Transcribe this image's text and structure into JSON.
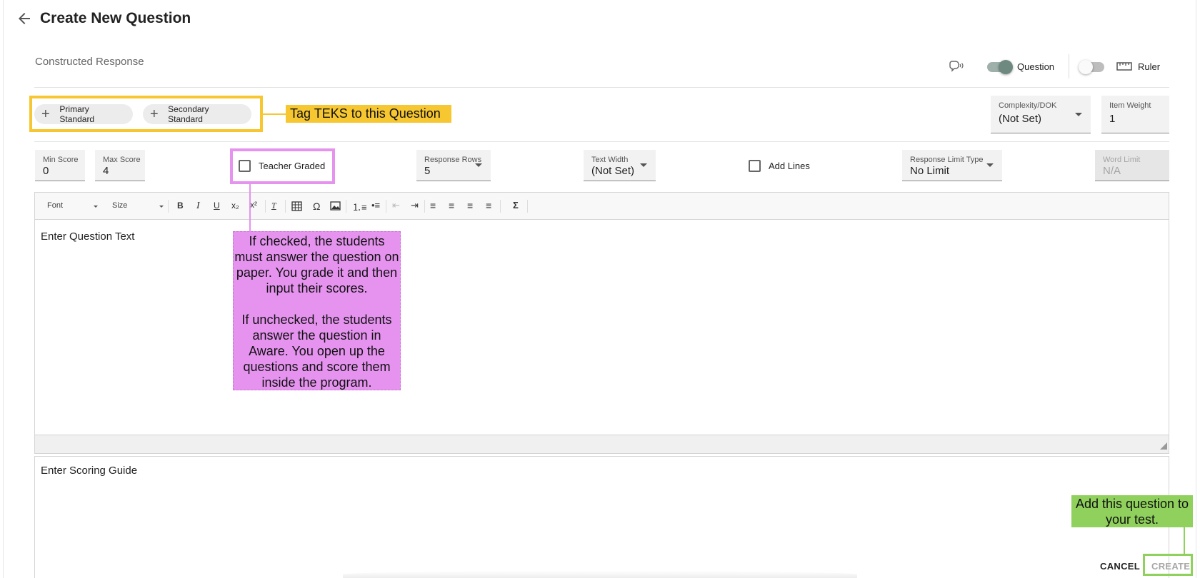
{
  "header": {
    "title": "Create New Question",
    "back_icon": "arrow-left-icon"
  },
  "question_type": "Constructed Response",
  "top_controls": {
    "question_label": "Question",
    "question_toggle_on": true,
    "ruler_label": "Ruler",
    "ruler_toggle_on": false
  },
  "standards": {
    "primary_label": "Primary Standard",
    "secondary_label": "Secondary Standard"
  },
  "complexity": {
    "label": "Complexity/DOK",
    "value": "(Not Set)"
  },
  "item_weight": {
    "label": "Item Weight",
    "value": "1"
  },
  "settings": {
    "min_score": {
      "label": "Min Score",
      "value": "0"
    },
    "max_score": {
      "label": "Max Score",
      "value": "4"
    },
    "teacher_graded": {
      "label": "Teacher Graded",
      "checked": false
    },
    "response_rows": {
      "label": "Response Rows",
      "value": "5"
    },
    "text_width": {
      "label": "Text Width",
      "value": "(Not Set)"
    },
    "add_lines": {
      "label": "Add Lines",
      "checked": false
    },
    "response_limit_type": {
      "label": "Response Limit Type",
      "value": "No Limit"
    },
    "word_limit": {
      "label": "Word Limit",
      "value": "N/A"
    }
  },
  "editor": {
    "font_label": "Font",
    "size_label": "Size",
    "question_placeholder": "Enter Question Text",
    "scoring_placeholder": "Enter Scoring Guide"
  },
  "annotations": {
    "teks": "Tag TEKS to this Question",
    "teacher_graded_note": "If checked, the students must answer the question on paper. You grade it and then input their scores.\n\nIf unchecked, the students answer the question in Aware. You open up the questions and score them inside the program.",
    "create_note": "Add this question to your test."
  },
  "footer": {
    "cancel_label": "CANCEL",
    "create_label": "CREATE"
  },
  "colors": {
    "yellow_annotation": "#f6c731",
    "pink_annotation": "#e593ef",
    "green_annotation": "#8fd15c",
    "toggle_on": "#6e8a80"
  }
}
